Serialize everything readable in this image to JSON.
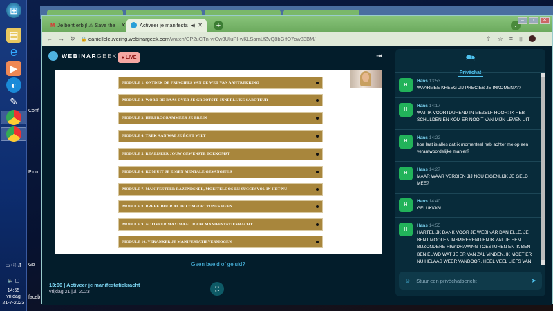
{
  "taskbar": {
    "clock_time": "14:55",
    "clock_day": "vrijdag",
    "clock_date": "21-7-2023",
    "desktop_labels": [
      "Confi",
      "Pinn",
      "Go",
      "faceb"
    ]
  },
  "browser": {
    "tabs": [
      {
        "label": "Je bent erbij! ⚠ Save the date! ⚠",
        "icon": "gmail-icon"
      },
      {
        "label": "Activeer je manifestatiekracht",
        "icon": "webinargeek-icon",
        "active": true
      }
    ],
    "url_host": "danielleleuvering.webinargeek.com",
    "url_path": "/watch/CP2uCTn-vrCw3UIuPI-wKLSamLfZvQ8bGifO7ow83BM/"
  },
  "header": {
    "logo_bold": "WEBINAR",
    "logo_light": "GEEK",
    "live_label": "LIVE"
  },
  "modules": [
    "MODULE 1. ONTDEK DE PRINCIPES VAN DE WET VAN AANTREKKING",
    "MODULE 2. WORD DE BAAS OVER JE GROOTSTE INNERLIJKE SABOTEUR",
    "MODULE 3. HERPROGRAMMEER JE BREIN",
    "MODULE 4. TREK AAN WAT JE ÉCHT WILT",
    "MODULE 5. REALISEER JOUW GEWENSTE TOEKOMST",
    "MODULE 6. KOM UIT JE EIGEN MENTALE GEVANGENIS",
    "MODULE 7. MANIFESTEER RAZENDSNEL, MOEITELOOS EN SUCCESVOL IN HET NU",
    "MODULE 8. BREEK DOOR AL JE COMFORTZONES HEEN",
    "MODULE 9. ACTIVEER MAXIMAAL JOUW MANIFESTATIEKRACHT",
    "MODULE 10. VERANKER JE MANIFESTATIEVERMOGEN"
  ],
  "player": {
    "no_sound_link": "Geen beeld of geluid?",
    "event_title": "13:00 | Activeer je manifestatiekracht",
    "event_date": "vrijdag 21 jul. 2023"
  },
  "chat": {
    "tab_label": "Privéchat",
    "input_placeholder": "Stuur een privéchatbericht",
    "messages": [
      {
        "avatar": "H",
        "name": "Hans",
        "time": "13:53",
        "text": "WAARMEE KREEG JIJ PRECIES JE INKOMEN???"
      },
      {
        "avatar": "H",
        "name": "Hans",
        "time": "14:17",
        "text": "WAT IK VOORTDUREND IN MEZELF HOOR: IK HEB SCHULDEN EN KOM ER NOOIT VAN MIJN LEVEN UIT"
      },
      {
        "avatar": "H",
        "name": "Hans",
        "time": "14:22",
        "text": "hoe laat is alles dat ik momenteel heb achter me op een verantwoordelijke manier?"
      },
      {
        "avatar": "H",
        "name": "Hans",
        "time": "14:27",
        "text": "MAAR WAAR VERDIEN JIJ NOU EIGENLIJK JE GELD MEE?"
      },
      {
        "avatar": "H",
        "name": "Hans",
        "time": "14:40",
        "text": "GELUKKIG!"
      },
      {
        "avatar": "H",
        "name": "Hans",
        "time": "14:55",
        "text": "HARTELIJK DANK VOOR JE WEBINAR DANIELLE, JE BENT MOOI EN INSPIREREND EN IK ZAL JE EEN BIJZONDERE HIWIDRAWING TOESTUREN EN IK BEN BENIEUWD WAT JE ER VAN ZAL VINDEN. IK MOET ER NU HELAAS WEER VANDOOR. HEEL VEEL LIEFS VAN HANS"
      }
    ]
  }
}
